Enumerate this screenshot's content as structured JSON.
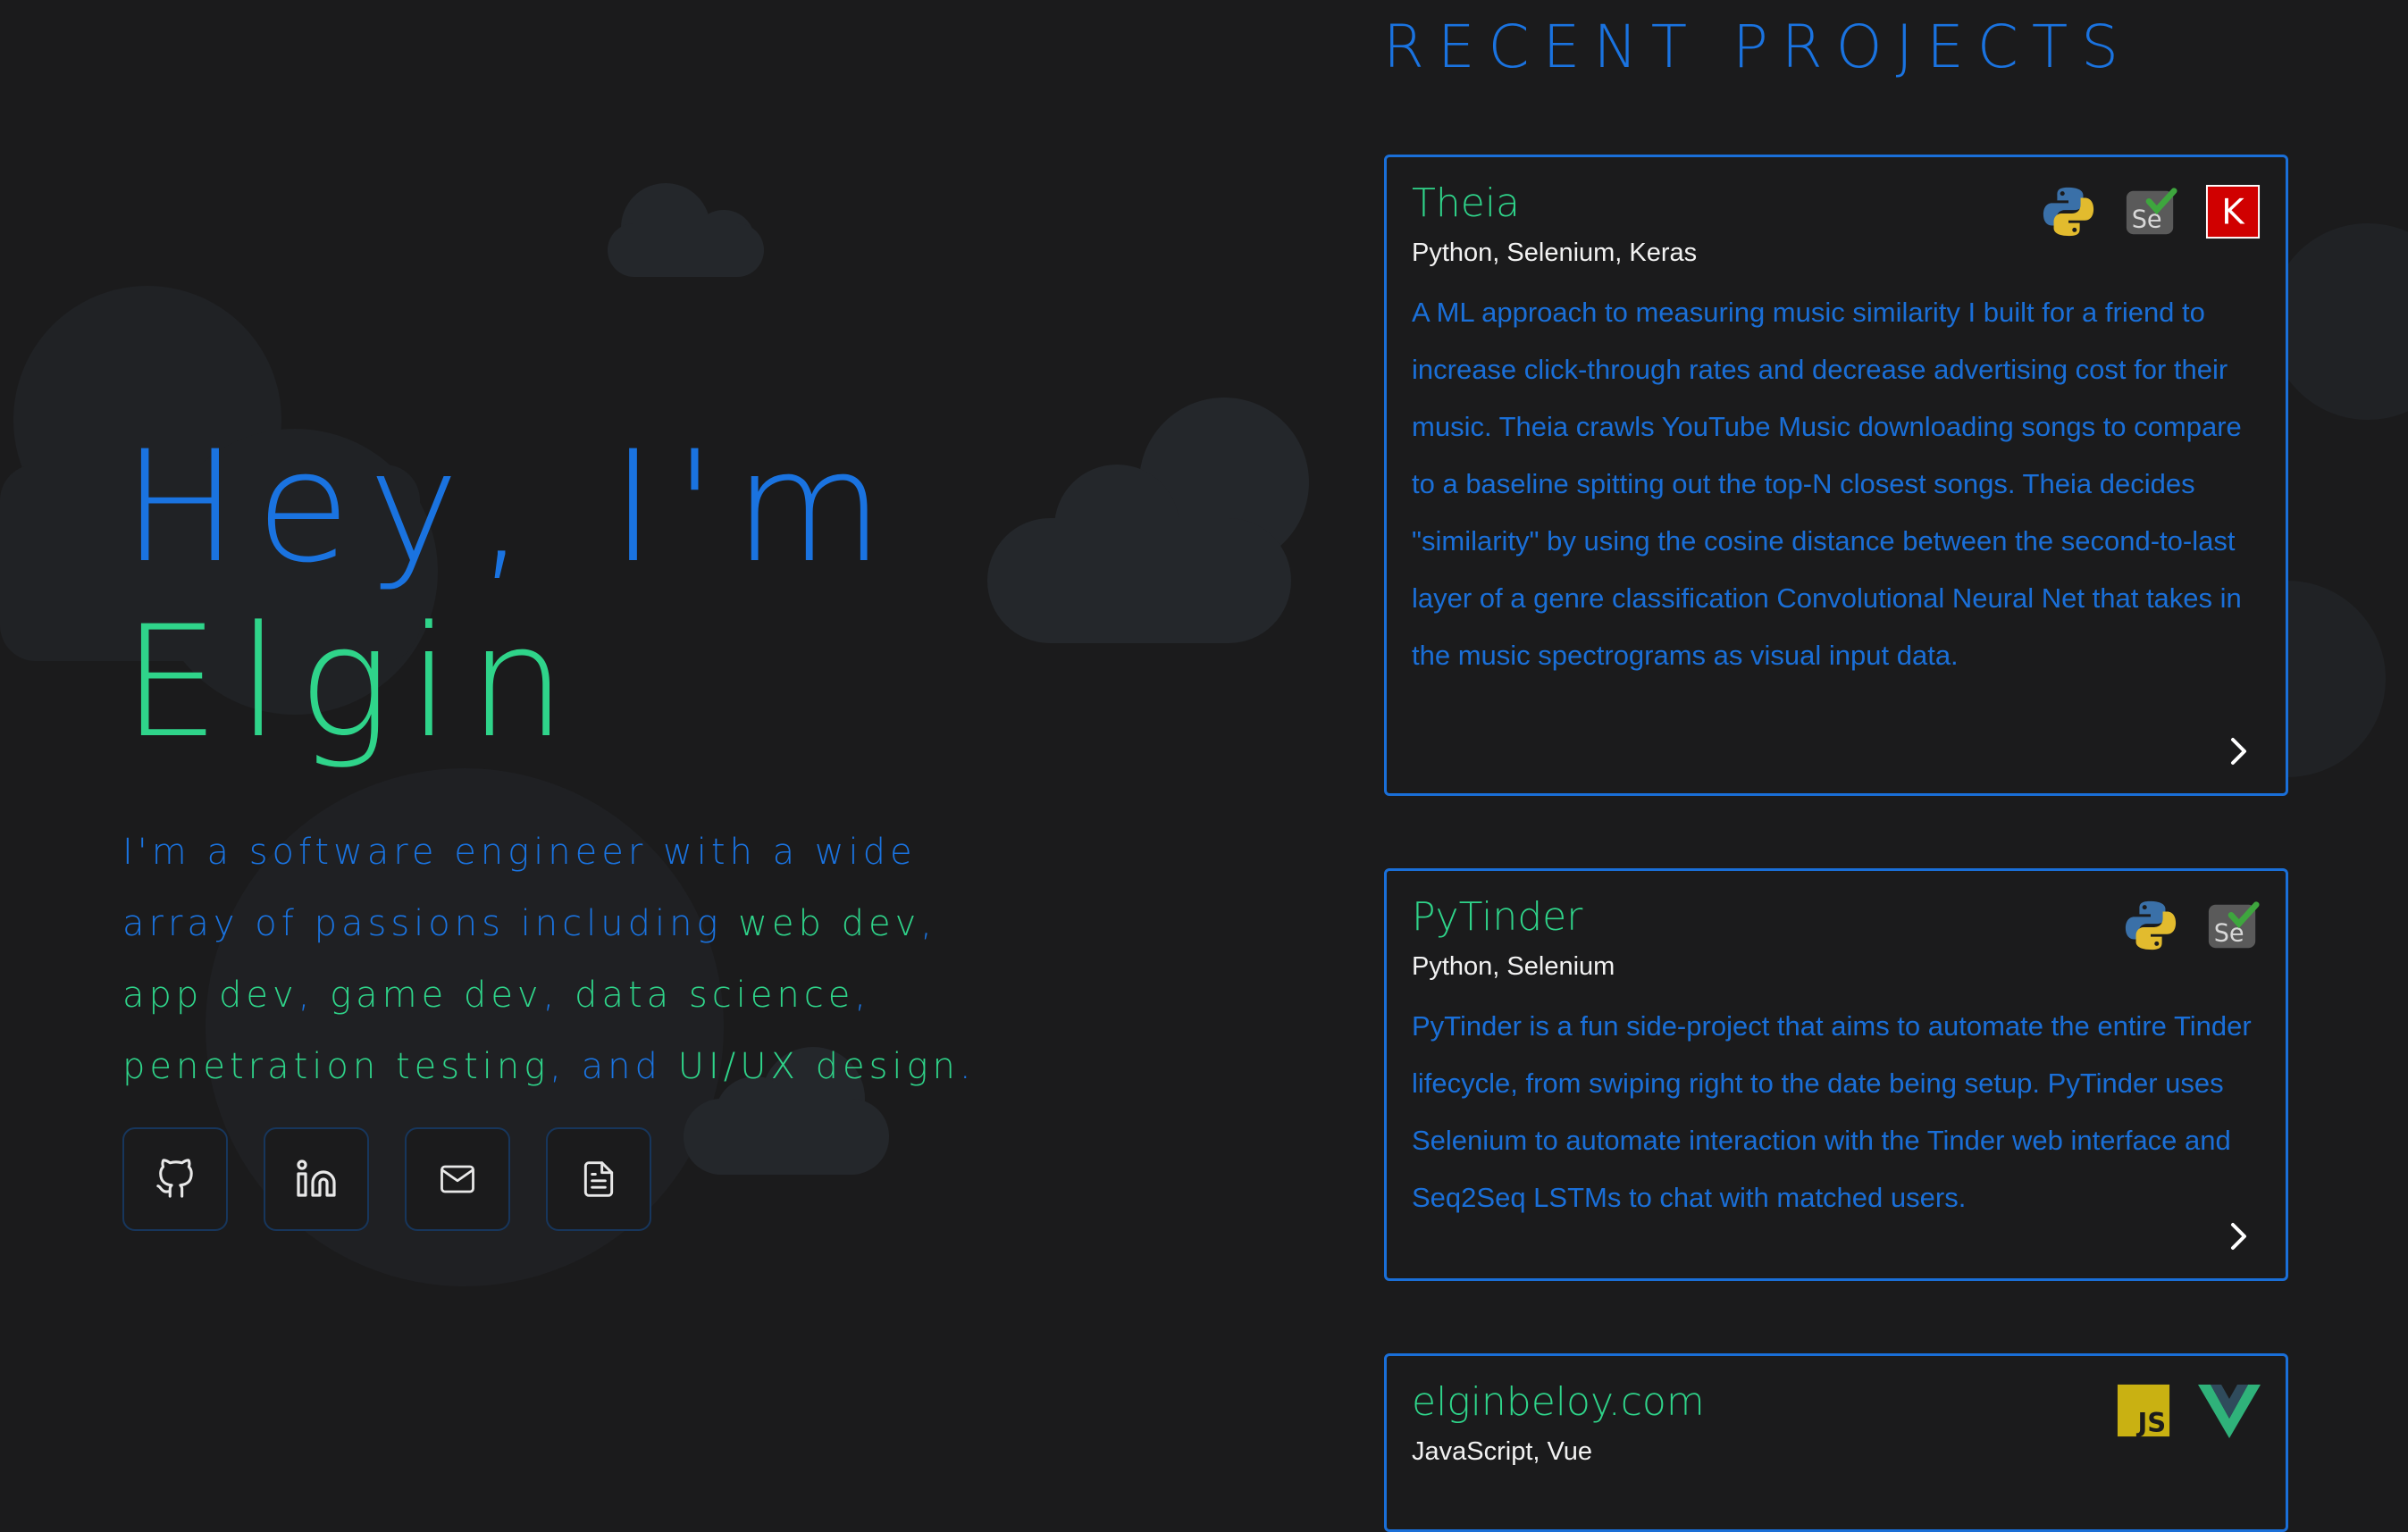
{
  "hero": {
    "greeting": "Hey, I'm",
    "name": "Elgin",
    "intro": {
      "pre": "I'm a software engineer with a wide array of passions including ",
      "web": "web dev",
      "c1": ", ",
      "app": "app dev",
      "c2": ", ",
      "game": "game dev",
      "c3": ", ",
      "data": "data science",
      "c4": ", ",
      "pen": "penetration testing",
      "c5": ", and ",
      "uiux": "UI/UX design",
      "end": "."
    }
  },
  "socials": [
    {
      "icon": "github-icon"
    },
    {
      "icon": "linkedin-icon"
    },
    {
      "icon": "mail-icon"
    },
    {
      "icon": "document-icon"
    }
  ],
  "projects": {
    "title": "RECENT PROJECTS",
    "items": [
      {
        "name": "Theia",
        "stack": "Python, Selenium, Keras",
        "description": "A ML approach to measuring music similarity I built for a friend to increase click-through rates and decrease advertising cost for their music. Theia crawls YouTube Music downloading songs to compare to a baseline spitting out the top-N closest songs. Theia decides \"similarity\" by using the cosine distance between the second-to-last layer of a genre classification Convolutional Neural Net that takes in the music spectrograms as visual input data.",
        "icons": [
          "python-icon",
          "selenium-icon",
          "keras-icon"
        ]
      },
      {
        "name": "PyTinder",
        "stack": "Python, Selenium",
        "description": "PyTinder is a fun side-project that aims to automate the entire Tinder lifecycle, from swiping right to the date being setup. PyTinder uses Selenium to automate interaction with the Tinder web interface and Seq2Seq LSTMs to chat with matched users.",
        "icons": [
          "python-icon",
          "selenium-icon"
        ]
      },
      {
        "name": "elginbeloy.com",
        "stack": "JavaScript, Vue",
        "description": "",
        "icons": [
          "javascript-icon",
          "vue-icon"
        ]
      }
    ]
  },
  "icon_text": {
    "selenium": "Se",
    "keras": "K",
    "javascript": "JS"
  },
  "colors": {
    "background": "#1b1b1c",
    "blue": "#1a73e0",
    "green": "#2fd48a",
    "cloud": "#23262a"
  }
}
